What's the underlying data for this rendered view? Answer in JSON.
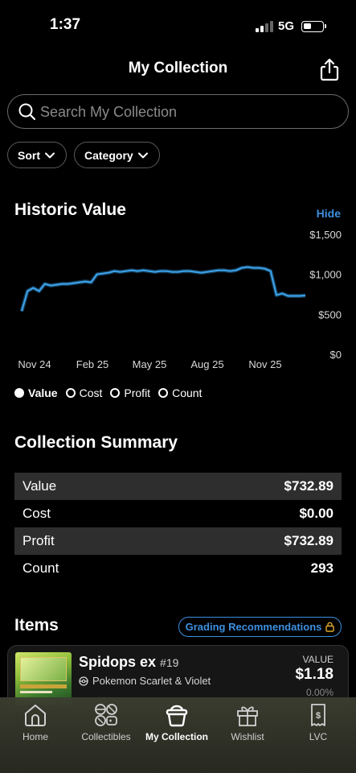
{
  "status": {
    "time": "1:37",
    "network": "5G"
  },
  "header": {
    "title": "My Collection"
  },
  "search": {
    "placeholder": "Search My Collection"
  },
  "filters": {
    "sort_label": "Sort",
    "category_label": "Category"
  },
  "historic": {
    "title": "Historic Value",
    "hide_label": "Hide",
    "legend": [
      {
        "label": "Value",
        "selected": true
      },
      {
        "label": "Cost",
        "selected": false
      },
      {
        "label": "Profit",
        "selected": false
      },
      {
        "label": "Count",
        "selected": false
      }
    ]
  },
  "chart_data": {
    "type": "line",
    "title": "",
    "xlabel": "",
    "ylabel": "",
    "x_ticks": [
      "Nov 24",
      "Feb 25",
      "May 25",
      "Aug 25",
      "Nov 25"
    ],
    "y_ticks": [
      "$1,500",
      "$1,000",
      "$500",
      "$0"
    ],
    "ylim": [
      0,
      1500
    ],
    "grid": false,
    "line_color": "#3aa0e8",
    "series": [
      {
        "values": [
          540,
          790,
          830,
          790,
          880,
          860,
          870,
          880,
          880,
          890,
          900,
          910,
          900,
          1000,
          1010,
          1020,
          1040,
          1030,
          1040,
          1050,
          1040,
          1050,
          1040,
          1030,
          1040,
          1040,
          1030,
          1030,
          1040,
          1040,
          1030,
          1020,
          1030,
          1040,
          1050,
          1050,
          1040,
          1050,
          1080,
          1090,
          1080,
          1080,
          1070,
          1040,
          740,
          760,
          730,
          730,
          730,
          735
        ]
      }
    ]
  },
  "summary": {
    "title": "Collection Summary",
    "rows": [
      {
        "label": "Value",
        "value": "$732.89"
      },
      {
        "label": "Cost",
        "value": "$0.00"
      },
      {
        "label": "Profit",
        "value": "$732.89"
      },
      {
        "label": "Count",
        "value": "293"
      }
    ]
  },
  "items": {
    "title": "Items",
    "grading_label": "Grading Recommendations",
    "list": [
      {
        "name": "Spidops ex",
        "number": "#19",
        "set": "Pokemon Scarlet & Violet",
        "value_label": "VALUE",
        "value": "$1.18",
        "change": "0.00%"
      }
    ]
  },
  "tabs": [
    {
      "label": "Home",
      "icon": "home-icon"
    },
    {
      "label": "Collectibles",
      "icon": "collectibles-icon"
    },
    {
      "label": "My Collection",
      "icon": "collection-pot-icon"
    },
    {
      "label": "Wishlist",
      "icon": "gift-icon"
    },
    {
      "label": "LVC",
      "icon": "receipt-icon"
    }
  ],
  "colors": {
    "accent": "#3d8fe0",
    "background": "#000000",
    "row_shade": "#2e2e2e"
  }
}
